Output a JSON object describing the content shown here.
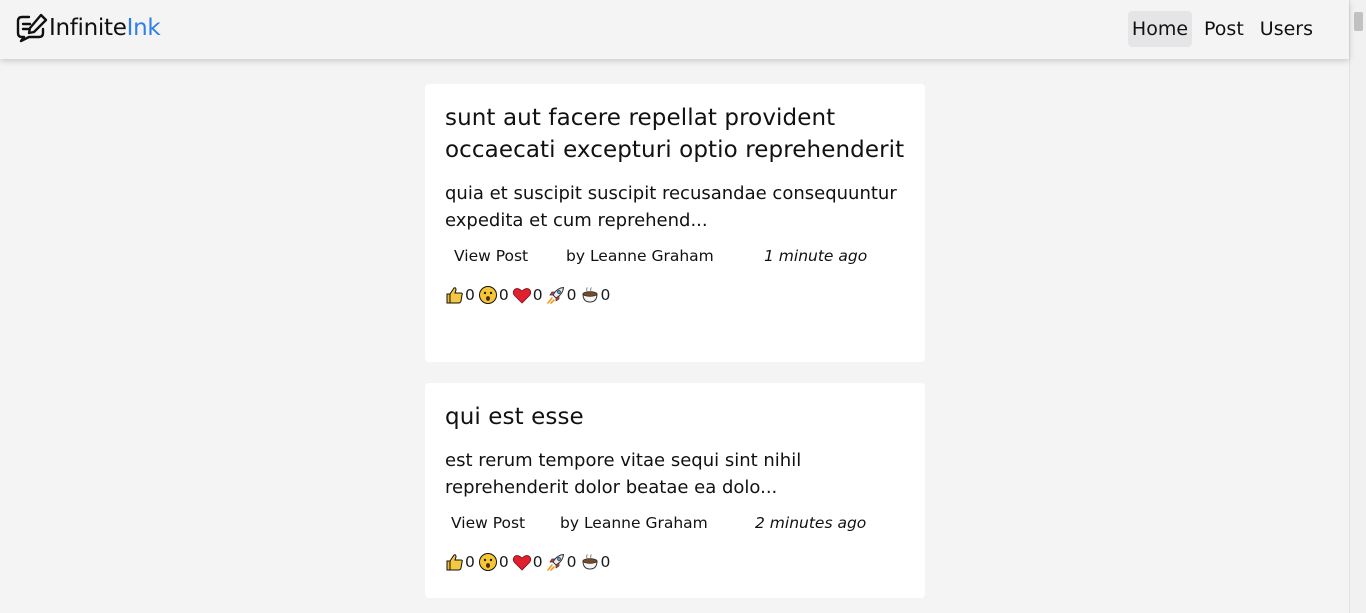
{
  "brand": {
    "part1": "Infinite",
    "part2": "Ink",
    "accent": "#2f7fe6"
  },
  "nav": {
    "home": "Home",
    "post": "Post",
    "users": "Users"
  },
  "posts": [
    {
      "title": "sunt aut facere repellat provident occaecati excepturi optio reprehenderit",
      "excerpt": "quia et suscipit suscipit recusandae consequuntur expedita et cum reprehend...",
      "view_label": "View Post",
      "author": "by Leanne Graham",
      "time": "1 minute ago",
      "reactions": {
        "thumbs_up": "0",
        "wow": "0",
        "heart": "0",
        "rocket": "0",
        "coffee": "0"
      }
    },
    {
      "title": "qui est esse",
      "excerpt": "est rerum tempore vitae sequi sint nihil reprehenderit dolor beatae ea dolo...",
      "view_label": "View Post",
      "author": "by Leanne Graham",
      "time": "2 minutes ago",
      "reactions": {
        "thumbs_up": "0",
        "wow": "0",
        "heart": "0",
        "rocket": "0",
        "coffee": "0"
      }
    }
  ]
}
